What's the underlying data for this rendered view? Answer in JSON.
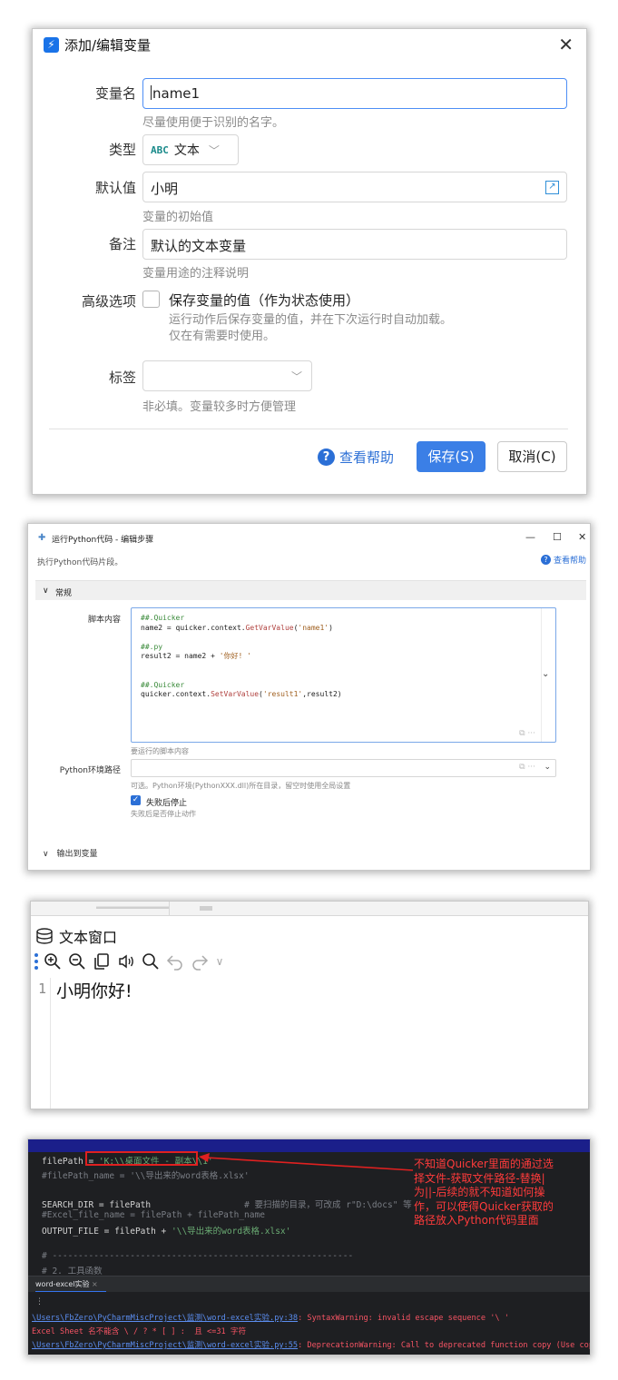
{
  "dialog1": {
    "title": "添加/编辑变量",
    "app_icon": "quicker-bolt-icon",
    "close_icon": "close-icon",
    "name_label": "变量名",
    "name_value": "name1",
    "name_hint": "尽量使用便于识别的名字。",
    "type_label": "类型",
    "type_icon_text": "ABC",
    "type_value": "文本",
    "default_label": "默认值",
    "default_value": "小明",
    "default_hint": "变量的初始值",
    "note_label": "备注",
    "note_value": "默认的文本变量",
    "note_hint": "变量用途的注释说明",
    "advanced_label": "高级选项",
    "save_state_label": "保存变量的值（作为状态使用）",
    "save_state_checked": false,
    "save_state_hint_1": "运行动作后保存变量的值，并在下次运行时自动加载。",
    "save_state_hint_2": "仅在有需要时使用。",
    "tags_label": "标签",
    "tags_hint": "非必填。变量较多时方便管理",
    "help_label": "查看帮助",
    "save_button": "保存(S)",
    "cancel_button": "取消(C)"
  },
  "dialog2": {
    "title": "运行Python代码 - 编辑步骤",
    "description": "执行Python代码片段。",
    "help_label": "查看帮助",
    "section_general": "常规",
    "script_label": "脚本内容",
    "code_lines": [
      "##.Quicker",
      "name2 = quicker.context.GetVarValue('name1')",
      "",
      "##.py",
      "result2 = name2 + '你好! '",
      "",
      "",
      "##.Quicker",
      "quicker.context.SetVarValue('result1',result2)"
    ],
    "script_hint": "要运行的脚本内容",
    "pyenv_label": "Python环境路径",
    "pyenv_hint": "可选。Python环境(PythonXXX.dll)所在目录，留空时使用全局设置",
    "stop_on_fail_label": "失败后停止",
    "stop_on_fail_checked": true,
    "stop_on_fail_hint": "失败后是否停止动作",
    "output_section": "输出到变量"
  },
  "window3": {
    "title": "文本窗口",
    "line_number": "1",
    "content": "小明你好!"
  },
  "ide4": {
    "code_lines": [
      "filePath = 'K:\\\\桌面文件 - 副本\\\\1'",
      "#filePath_name = '\\\\导出来的word表格.xlsx'",
      "",
      "SEARCH_DIR = filePath                  # 要扫描的目录，可改成 r\"D:\\docs\" 等",
      "#Excel_file_name = filePath + filePath_name",
      "OUTPUT_FILE = filePath + '\\\\导出来的word表格.xlsx'",
      "",
      "# ----------------------------------------------------------",
      "# 2. 工具函数"
    ],
    "annotation": "不知道Quicker里面的通过选择文件-获取文件路径-替换|为||-后续的就不知道如何操作，可以使得Quicker获取的路径放入Python代码里面",
    "run_tab": "word-excel实验",
    "terminal_prompt": "⋮",
    "error_line_1_path": "\\Users\\FbZero\\PyCharmMiscProject\\监测\\word-excel实验.py:38",
    "error_line_1_msg": ": SyntaxWarning: invalid escape sequence '\\ '",
    "error_line_2": "Excel Sheet 名不能含 \\ / ? * [ ] :  且 <=31 字符",
    "error_line_3_path": "\\Users\\FbZero\\PyCharmMiscProject\\监测\\word-excel实验.py:55",
    "error_line_3_msg": ": DeprecationWarning: Call to deprecated function copy (Use cop"
  },
  "colors": {
    "primary": "#3b7fe6",
    "annotation_red": "#ff3b3b",
    "ide_bg": "#1e1f22"
  }
}
